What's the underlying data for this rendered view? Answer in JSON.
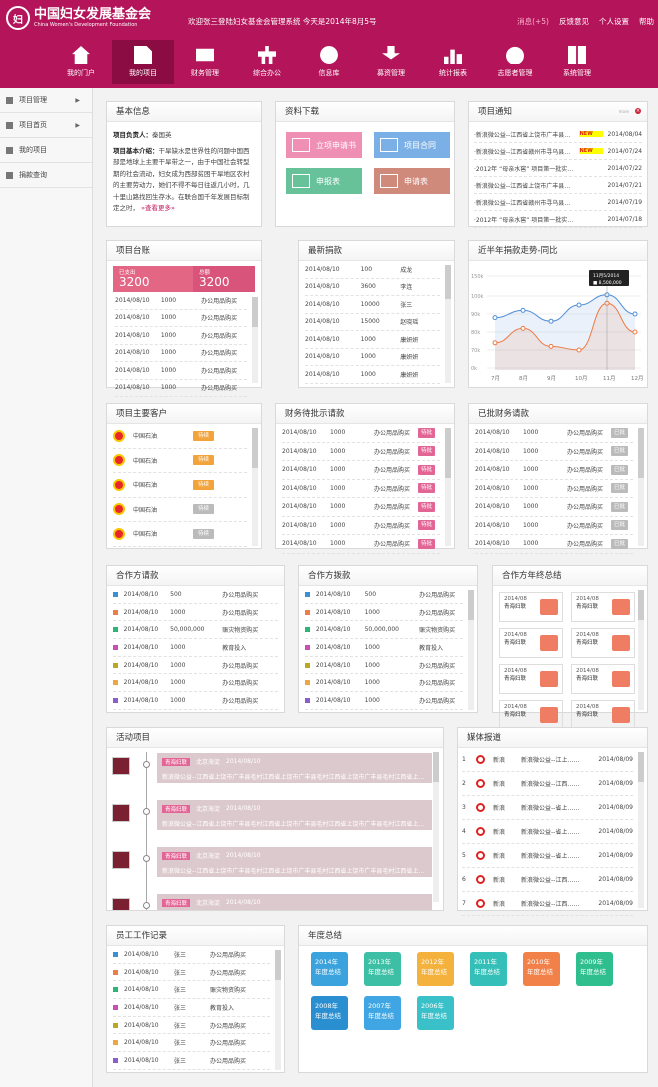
{
  "header": {
    "logo_mark": "妇",
    "logo_cn": "中国妇女发展基金会",
    "logo_en": "China Women's Development Foundation",
    "welcome": "欢迎张三登陆妇女基金会管理系统   今天是2014年8月5号",
    "links": [
      "消息(+5)",
      "反馈意见",
      "个人设置",
      "帮助"
    ]
  },
  "nav": [
    {
      "label": "我的门户",
      "icon": "home-icon"
    },
    {
      "label": "我的项目",
      "icon": "project-doc-icon",
      "active": true
    },
    {
      "label": "财务管理",
      "icon": "finance-card-icon"
    },
    {
      "label": "综合办公",
      "icon": "office-tree-icon"
    },
    {
      "label": "信息库",
      "icon": "info-icon"
    },
    {
      "label": "募资管理",
      "icon": "money-icon"
    },
    {
      "label": "统计报表",
      "icon": "bar-chart-icon"
    },
    {
      "label": "志愿者管理",
      "icon": "people-icon"
    },
    {
      "label": "系统管理",
      "icon": "system-icon"
    }
  ],
  "sidebar": [
    {
      "label": "项目管理",
      "arrow": "▶"
    },
    {
      "label": "项目首页",
      "arrow": "▶"
    },
    {
      "label": "我的项目",
      "arrow": ""
    },
    {
      "label": "捐款查询",
      "arrow": ""
    }
  ],
  "basic": {
    "title": "基本信息",
    "leader_label": "项目负责人：",
    "leader": "秦国英",
    "intro_label": "项目基本介绍：",
    "intro": "干旱缺水是世界性的问题中国西部是地球上主要干旱带之一，由于中国社会转型期的社会流动，妇女成为西部贫困干旱地区农村的主要劳动力，她们不得不每日往返几小时，几十里山路找回生存水。在联合国千年发展目标制定之时，",
    "more": "»查看更多»"
  },
  "download": {
    "title": "资料下载",
    "items": [
      {
        "label": "立项申请书",
        "color": "#ef8fb3"
      },
      {
        "label": "项目合同",
        "color": "#7bb0e6"
      },
      {
        "label": "申报表",
        "color": "#67c29a"
      },
      {
        "label": "申请表",
        "color": "#cf8a7c"
      }
    ]
  },
  "notice": {
    "title": "项目通知",
    "more": "more",
    "new_badge": "NEW",
    "rows": [
      {
        "text": "·新浪微公益--江西省上饶市广丰县…",
        "date": "2014/08/04",
        "new": true
      },
      {
        "text": "·新浪微公益--江西省赣州市寻乌县…",
        "date": "2014/07/24",
        "new": true
      },
      {
        "text": "·2012年 “母亲水窖” 项目第一批实…",
        "date": "2014/07/22",
        "new": false
      },
      {
        "text": "·新浪微公益--江西省上饶市广丰县…",
        "date": "2014/07/21",
        "new": false
      },
      {
        "text": "·新浪微公益--江西省赣州市寻乌县…",
        "date": "2014/07/19",
        "new": false
      },
      {
        "text": "·2012年 “母亲水窖” 项目第一批实…",
        "date": "2014/07/18",
        "new": false
      }
    ]
  },
  "ledger": {
    "title": "项目台账",
    "spent_label": "已支出",
    "spent": "3200",
    "total_label": "总额",
    "total": "3200",
    "rows": [
      {
        "date": "2014/08/10",
        "amount": "1000",
        "item": "办公用品购买"
      },
      {
        "date": "2014/08/10",
        "amount": "1000",
        "item": "办公用品购买"
      },
      {
        "date": "2014/08/10",
        "amount": "1000",
        "item": "办公用品购买"
      },
      {
        "date": "2014/08/10",
        "amount": "1000",
        "item": "办公用品购买"
      },
      {
        "date": "2014/08/10",
        "amount": "1000",
        "item": "办公用品购买"
      },
      {
        "date": "2014/08/10",
        "amount": "1000",
        "item": "办公用品购买"
      }
    ]
  },
  "donations": {
    "title": "最新捐款",
    "rows": [
      {
        "date": "2014/08/10",
        "amount": "100",
        "name": "成龙"
      },
      {
        "date": "2014/08/10",
        "amount": "3600",
        "name": "李连"
      },
      {
        "date": "2014/08/10",
        "amount": "10000",
        "name": "张三"
      },
      {
        "date": "2014/08/10",
        "amount": "15000",
        "name": "赵晓瑶"
      },
      {
        "date": "2014/08/10",
        "amount": "1000",
        "name": "康妍妍"
      },
      {
        "date": "2014/08/10",
        "amount": "1000",
        "name": "康妍妍"
      },
      {
        "date": "2014/08/10",
        "amount": "1000",
        "name": "康妍妍"
      }
    ]
  },
  "trend": {
    "title": "近半年捐款走势-同比",
    "tooltip_date": "11月5/2014",
    "tooltip_value": "8,500,000",
    "colors": {
      "blue": "#4f8fd6",
      "orange": "#ee7a44"
    }
  },
  "chart_data": {
    "type": "line",
    "categories": [
      "7月",
      "8月",
      "9月",
      "10月",
      "11月",
      "12月"
    ],
    "y_ticks": [
      "150k",
      "100k",
      "90k",
      "80k",
      "70k",
      "0k"
    ],
    "ylim": [
      0,
      150
    ],
    "series": [
      {
        "values": [
          88,
          92,
          86,
          95,
          103,
          90
        ]
      },
      {
        "values": [
          74,
          82,
          72,
          70,
          96,
          80
        ]
      }
    ]
  },
  "customers": {
    "title": "项目主要客户",
    "rows": [
      {
        "name": "中国石油",
        "status": "待续",
        "style": "orange"
      },
      {
        "name": "中国石油",
        "status": "待续",
        "style": "orange"
      },
      {
        "name": "中国石油",
        "status": "待续",
        "style": "orange"
      },
      {
        "name": "中国石油",
        "status": "待续",
        "style": "gray"
      },
      {
        "name": "中国石油",
        "status": "待续",
        "style": "gray"
      }
    ]
  },
  "pending": {
    "title": "财务待批示请款",
    "rows": [
      {
        "date": "2014/08/10",
        "amount": "1000",
        "item": "办公用品购买",
        "status": "待批"
      },
      {
        "date": "2014/08/10",
        "amount": "1000",
        "item": "办公用品购买",
        "status": "待批"
      },
      {
        "date": "2014/08/10",
        "amount": "1000",
        "item": "办公用品购买",
        "status": "待批"
      },
      {
        "date": "2014/08/10",
        "amount": "1000",
        "item": "办公用品购买",
        "status": "待批"
      },
      {
        "date": "2014/08/10",
        "amount": "1000",
        "item": "办公用品购买",
        "status": "待批"
      },
      {
        "date": "2014/08/10",
        "amount": "1000",
        "item": "办公用品购买",
        "status": "待批"
      },
      {
        "date": "2014/08/10",
        "amount": "1000",
        "item": "办公用品购买",
        "status": "待批"
      }
    ]
  },
  "approved": {
    "title": "已批财务请款",
    "rows": [
      {
        "date": "2014/08/10",
        "amount": "1000",
        "item": "办公用品购买",
        "status": "已批"
      },
      {
        "date": "2014/08/10",
        "amount": "1000",
        "item": "办公用品购买",
        "status": "已批"
      },
      {
        "date": "2014/08/10",
        "amount": "1000",
        "item": "办公用品购买",
        "status": "已批"
      },
      {
        "date": "2014/08/10",
        "amount": "1000",
        "item": "办公用品购买",
        "status": "已批"
      },
      {
        "date": "2014/08/10",
        "amount": "1000",
        "item": "办公用品购买",
        "status": "已批"
      },
      {
        "date": "2014/08/10",
        "amount": "1000",
        "item": "办公用品购买",
        "status": "已批"
      },
      {
        "date": "2014/08/10",
        "amount": "1000",
        "item": "办公用品购买",
        "status": "已批"
      }
    ]
  },
  "partner_request": {
    "title": "合作方请款",
    "rows": [
      {
        "color": "#3b8fd3",
        "date": "2014/08/10",
        "amount": "500",
        "item": "办公用品购买"
      },
      {
        "color": "#ef7d45",
        "date": "2014/08/10",
        "amount": "1000",
        "item": "办公用品购买"
      },
      {
        "color": "#2bb673",
        "date": "2014/08/10",
        "amount": "50,000,000",
        "item": "赈灾物资购买"
      },
      {
        "color": "#c94fb3",
        "date": "2014/08/10",
        "amount": "1000",
        "item": "教育投入"
      },
      {
        "color": "#b8a822",
        "date": "2014/08/10",
        "amount": "1000",
        "item": "办公用品购买"
      },
      {
        "color": "#f0a640",
        "date": "2014/08/10",
        "amount": "1000",
        "item": "办公用品购买"
      },
      {
        "color": "#8a5fc9",
        "date": "2014/08/10",
        "amount": "1000",
        "item": "办公用品购买"
      }
    ]
  },
  "partner_payment": {
    "title": "合作方拨款",
    "rows": [
      {
        "color": "#3b8fd3",
        "date": "2014/08/10",
        "amount": "500",
        "item": "办公用品购买"
      },
      {
        "color": "#ef7d45",
        "date": "2014/08/10",
        "amount": "1000",
        "item": "办公用品购买"
      },
      {
        "color": "#2bb673",
        "date": "2014/08/10",
        "amount": "50,000,000",
        "item": "赈灾物资购买"
      },
      {
        "color": "#c94fb3",
        "date": "2014/08/10",
        "amount": "1000",
        "item": "教育投入"
      },
      {
        "color": "#b8a822",
        "date": "2014/08/10",
        "amount": "1000",
        "item": "办公用品购买"
      },
      {
        "color": "#f0a640",
        "date": "2014/08/10",
        "amount": "1000",
        "item": "办公用品购买"
      },
      {
        "color": "#8a5fc9",
        "date": "2014/08/10",
        "amount": "1000",
        "item": "办公用品购买"
      }
    ]
  },
  "partner_summary": {
    "title": "合作方年终总结",
    "items": [
      {
        "date": "2014/08",
        "org": "青海妇联"
      },
      {
        "date": "2014/08",
        "org": "青海妇联"
      },
      {
        "date": "2014/08",
        "org": "青海妇联"
      },
      {
        "date": "2014/08",
        "org": "青海妇联"
      },
      {
        "date": "2014/08",
        "org": "青海妇联"
      },
      {
        "date": "2014/08",
        "org": "青海妇联"
      },
      {
        "date": "2014/08",
        "org": "青海妇联"
      },
      {
        "date": "2014/08",
        "org": "青海妇联"
      }
    ]
  },
  "activities": {
    "title": "活动项目",
    "items": [
      {
        "tag": "青海妇联",
        "loc": "北京海淀",
        "date": "2014/08/10",
        "text": "新浪微公益--江西省上饶市广丰县毛村江西省上饶市广丰县毛村江西省上饶市广丰县毛村江西省上…"
      },
      {
        "tag": "青海妇联",
        "loc": "北京海淀",
        "date": "2014/08/10",
        "text": "新浪微公益--江西省上饶市广丰县毛村江西省上饶市广丰县毛村江西省上饶市广丰县毛村江西省上…"
      },
      {
        "tag": "青海妇联",
        "loc": "北京海淀",
        "date": "2014/08/10",
        "text": "新浪微公益--江西省上饶市广丰县毛村江西省上饶市广丰县毛村江西省上饶市广丰县毛村江西省上…"
      },
      {
        "tag": "青海妇联",
        "loc": "北京海淀",
        "date": "2014/08/10",
        "text": "新浪微公益--江西省上饶市广丰县毛村江西省上饶市广丰县毛村江西省上饶市广丰县毛村江西省上…"
      }
    ]
  },
  "media": {
    "title": "媒体报道",
    "rows": [
      {
        "n": "1",
        "source": "新浪",
        "text": "新浪微公益--江上……",
        "date": "2014/08/09"
      },
      {
        "n": "2",
        "source": "新浪",
        "text": "新浪微公益--江西……",
        "date": "2014/08/09"
      },
      {
        "n": "3",
        "source": "新浪",
        "text": "新浪微公益--省上……",
        "date": "2014/08/09"
      },
      {
        "n": "4",
        "source": "新浪",
        "text": "新浪微公益--省上……",
        "date": "2014/08/09"
      },
      {
        "n": "5",
        "source": "新浪",
        "text": "新浪微公益--省上……",
        "date": "2014/08/09"
      },
      {
        "n": "6",
        "source": "新浪",
        "text": "新浪微公益--江西……",
        "date": "2014/08/09"
      },
      {
        "n": "7",
        "source": "新浪",
        "text": "新浪微公益--江西……",
        "date": "2014/08/09"
      }
    ]
  },
  "staff": {
    "title": "员工工作记录",
    "rows": [
      {
        "color": "#3b8fd3",
        "date": "2014/08/10",
        "name": "张三",
        "item": "办公用品购买"
      },
      {
        "color": "#ef7d45",
        "date": "2014/08/10",
        "name": "张三",
        "item": "办公用品购买"
      },
      {
        "color": "#2bb673",
        "date": "2014/08/10",
        "name": "张三",
        "item": "赈灾物资购买"
      },
      {
        "color": "#c94fb3",
        "date": "2014/08/10",
        "name": "张三",
        "item": "教育投入"
      },
      {
        "color": "#b8a822",
        "date": "2014/08/10",
        "name": "张三",
        "item": "办公用品购买"
      },
      {
        "color": "#f0a640",
        "date": "2014/08/10",
        "name": "张三",
        "item": "办公用品购买"
      },
      {
        "color": "#8a5fc9",
        "date": "2014/08/10",
        "name": "张三",
        "item": "办公用品购买"
      }
    ]
  },
  "annual": {
    "title": "年度总结",
    "items": [
      {
        "year": "2014年",
        "label": "年度总结",
        "color": "#3aa3dd"
      },
      {
        "year": "2013年",
        "label": "年度总结",
        "color": "#3cbfa4"
      },
      {
        "year": "2012年",
        "label": "年度总结",
        "color": "#f4b13c"
      },
      {
        "year": "2011年",
        "label": "年度总结",
        "color": "#34c0b8"
      },
      {
        "year": "2010年",
        "label": "年度总结",
        "color": "#f28149"
      },
      {
        "year": "2009年",
        "label": "年度总结",
        "color": "#2fbf8e"
      },
      {
        "year": "2008年",
        "label": "年度总结",
        "color": "#2a8fd0"
      },
      {
        "year": "2007年",
        "label": "年度总结",
        "color": "#3fa6e3"
      },
      {
        "year": "2006年",
        "label": "年度总结",
        "color": "#39c0c8"
      }
    ]
  }
}
